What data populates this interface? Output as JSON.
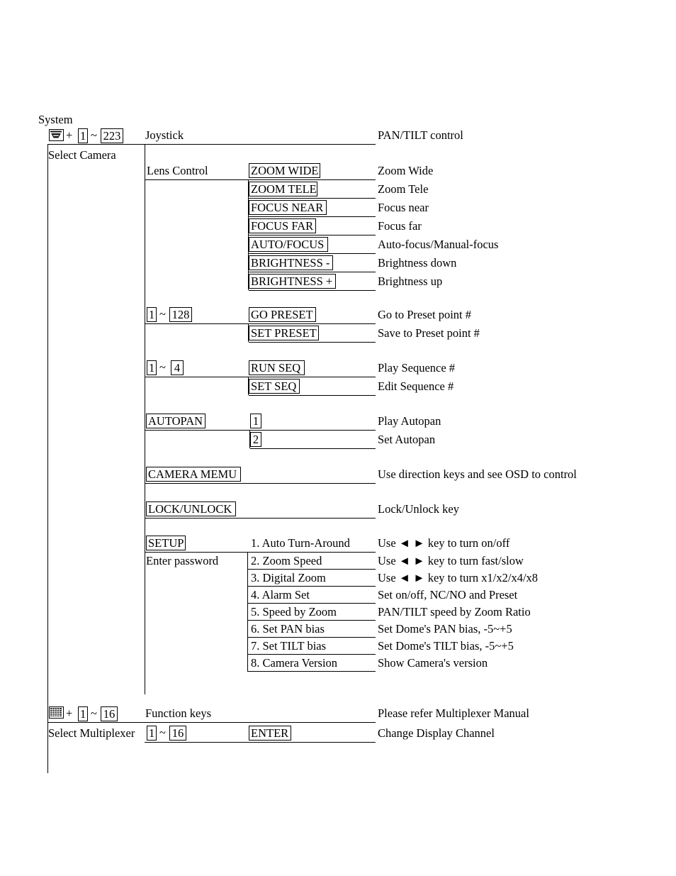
{
  "title_labels": {
    "system": "System",
    "select_camera": "Select Camera",
    "select_multiplexer": "Select Multiplexer",
    "enter_password": "Enter password",
    "function_keys": "Function keys"
  },
  "icons": {
    "dome": "dome-camera-icon",
    "grid": "multiplexer-grid-icon",
    "plus": "+",
    "tilde": "~"
  },
  "camera_row": {
    "range_from": "1",
    "range_to": "223",
    "action": "Joystick",
    "description": "PAN/TILT control"
  },
  "lens_control": {
    "label": "Lens Control",
    "rows": [
      {
        "key": "ZOOM WIDE",
        "desc": "Zoom Wide"
      },
      {
        "key": "ZOOM TELE",
        "desc": "Zoom Tele"
      },
      {
        "key": "FOCUS NEAR",
        "desc": "Focus near"
      },
      {
        "key": "FOCUS FAR",
        "desc": "Focus far"
      },
      {
        "key": "AUTO/FOCUS",
        "desc": "Auto-focus/Manual-focus"
      },
      {
        "key": "BRIGHTNESS -",
        "desc": "Brightness down"
      },
      {
        "key": "BRIGHTNESS +",
        "desc": "Brightness up"
      }
    ]
  },
  "preset": {
    "range_from": "1",
    "range_to": "128",
    "rows": [
      {
        "key": "GO PRESET",
        "desc": "Go to Preset point #"
      },
      {
        "key": "SET PRESET",
        "desc": "Save to Preset point #"
      }
    ]
  },
  "sequence": {
    "range_from": "1",
    "range_to": "4",
    "rows": [
      {
        "key": "RUN SEQ",
        "desc": "Play Sequence #"
      },
      {
        "key": "SET SEQ",
        "desc": "Edit Sequence #"
      }
    ]
  },
  "autopan": {
    "label": "AUTOPAN",
    "rows": [
      {
        "key": "1",
        "desc": "Play Autopan"
      },
      {
        "key": "2",
        "desc": "Set Autopan"
      }
    ]
  },
  "camera_menu": {
    "label": "CAMERA MEMU",
    "desc": "Use direction keys and see OSD to control"
  },
  "lock_unlock": {
    "label": "LOCK/UNLOCK",
    "desc": "Lock/Unlock key"
  },
  "setup": {
    "label": "SETUP",
    "rows": [
      {
        "key": "1. Auto Turn-Around",
        "desc": "Use ◄ ► key to turn on/off"
      },
      {
        "key": "2. Zoom Speed",
        "desc": "Use ◄ ► key to turn fast/slow"
      },
      {
        "key": "3. Digital Zoom",
        "desc": "Use ◄ ► key to turn x1/x2/x4/x8"
      },
      {
        "key": "4. Alarm Set",
        "desc": "Set on/off, NC/NO and Preset"
      },
      {
        "key": "5. Speed by Zoom",
        "desc": "PAN/TILT speed by Zoom Ratio"
      },
      {
        "key": "6. Set PAN bias",
        "desc": "Set Dome's PAN bias, -5~+5"
      },
      {
        "key": "7. Set TILT bias",
        "desc": "Set Dome's TILT bias, -5~+5"
      },
      {
        "key": "8. Camera Version",
        "desc": "Show Camera's version"
      }
    ]
  },
  "multiplexer": {
    "range_from": "1",
    "range_to": "16",
    "function_desc": "Please refer Multiplexer Manual",
    "channel_from": "1",
    "channel_to": "16",
    "enter_key": "ENTER",
    "channel_desc": "Change Display Channel"
  },
  "colors": {
    "ink": "#000000",
    "paper": "#ffffff"
  }
}
